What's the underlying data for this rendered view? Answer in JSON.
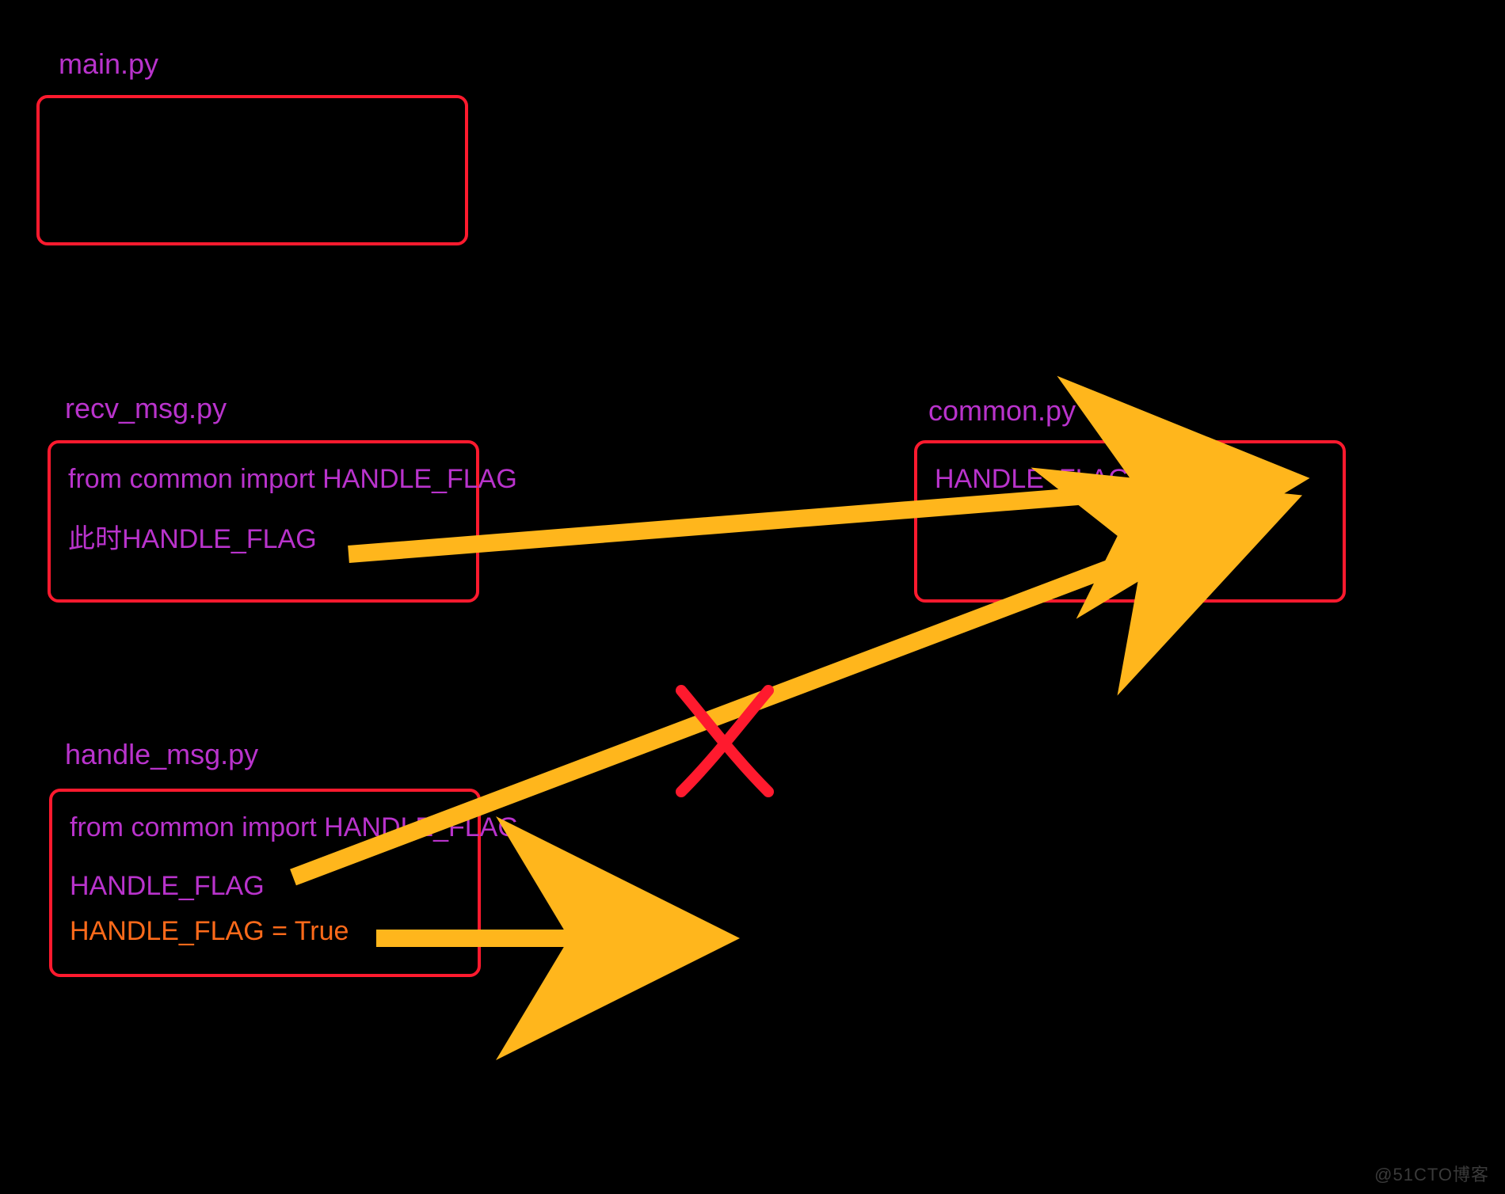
{
  "main": {
    "label": "main.py"
  },
  "recv": {
    "label": "recv_msg.py",
    "line1": "from common import HANDLE_FLAG",
    "line2": "此时HANDLE_FLAG"
  },
  "common": {
    "label": "common.py",
    "line1": "HANDLE_FLAG = False"
  },
  "handle": {
    "label": "handle_msg.py",
    "line1": "from common import HANDLE_FLAG",
    "line2": "HANDLE_FLAG",
    "line3": "HANDLE_FLAG = True"
  },
  "true_label": "True",
  "watermark": "@51CTO博客"
}
